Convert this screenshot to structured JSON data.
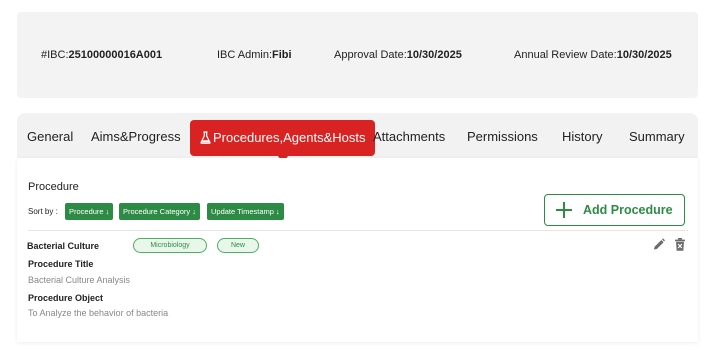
{
  "header": {
    "ibc_label": "#IBC:",
    "ibc_value": "25100000016A001",
    "admin_label": "IBC Admin:",
    "admin_value": "Fibi",
    "approval_label": "Approval Date:",
    "approval_value": "10/30/2025",
    "review_label": "Annual Review Date:",
    "review_value": "10/30/2025"
  },
  "tabs": [
    {
      "label": "General"
    },
    {
      "label": "Aims&Progress"
    },
    {
      "label": "Procedures,Agents&Hosts",
      "active": true
    },
    {
      "label": "Attachments"
    },
    {
      "label": "Permissions"
    },
    {
      "label": "History"
    },
    {
      "label": "Summary"
    }
  ],
  "procedure_section": {
    "title": "Procedure",
    "sort_label": "Sort by :",
    "sort_buttons": [
      "Procedure ↓",
      "Procedure Category ↓",
      "Update Timestamp ↓"
    ],
    "add_button": "Add Procedure"
  },
  "procedure": {
    "name": "Bacterial Culture",
    "tags": [
      "Microbiology",
      "New"
    ],
    "title_label": "Procedure Title",
    "title_value": "Bacterial Culture Analysis",
    "object_label": "Procedure Object",
    "object_value": "To Analyze the behavior of bacteria"
  },
  "icons": [
    "flask-icon",
    "plus-icon",
    "edit-icon",
    "delete-icon"
  ],
  "colors": {
    "accent_red": "#d92323",
    "accent_green": "#2e8b46",
    "tag_bg": "#e8f7ea"
  }
}
